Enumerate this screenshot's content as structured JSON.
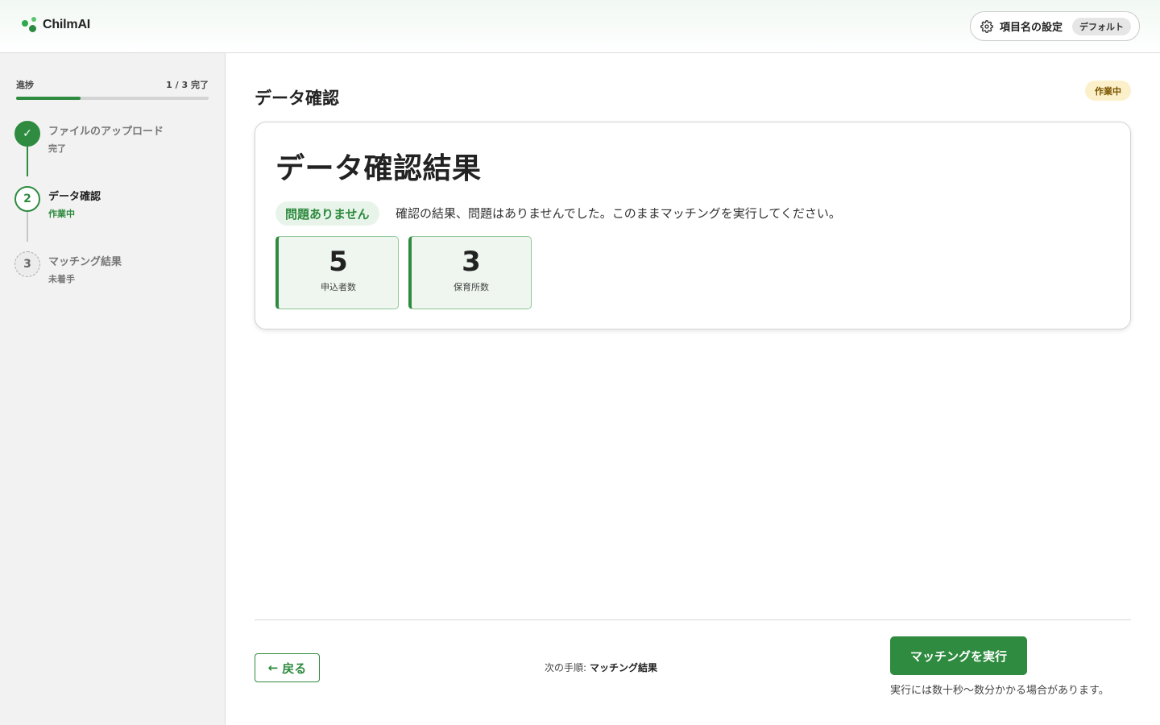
{
  "app": {
    "name": "ChilmAI",
    "settings_label": "項目名の設定",
    "settings_badge": "デフォルト"
  },
  "sidebar": {
    "progress_label": "進捗",
    "progress_count": "1 / 3 完了",
    "progress_fraction": 0.333,
    "steps": [
      {
        "marker": "✓",
        "title": "ファイルのアップロード",
        "status": "完了",
        "state": "done"
      },
      {
        "marker": "2",
        "title": "データ確認",
        "status": "作業中",
        "state": "active"
      },
      {
        "marker": "3",
        "title": "マッチング結果",
        "status": "未着手",
        "state": "todo"
      }
    ]
  },
  "main": {
    "page_title": "データ確認",
    "status_pill": "作業中",
    "card": {
      "title": "データ確認結果",
      "ok_badge": "問題ありません",
      "message": "確認の結果、問題はありませんでした。このままマッチングを実行してください。",
      "stats": [
        {
          "value": "5",
          "caption": "申込者数"
        },
        {
          "value": "3",
          "caption": "保育所数"
        }
      ]
    }
  },
  "footer": {
    "back_arrow": "←",
    "back_label": "戻る",
    "next_prefix": "次の手順:",
    "next_value": "マッチング結果",
    "run_label": "マッチングを実行",
    "run_note": "実行には数十秒〜数分かかる場合があります。"
  },
  "colors": {
    "accent": "#2e8b3f",
    "accent_bg": "#eef6ef",
    "working_bg": "#fbf0c9",
    "working_text": "#7a5400"
  },
  "icons": {
    "settings": "gear-icon",
    "logo": "chilmai-logo-mark",
    "back": "arrow-left-icon",
    "done": "check-icon"
  }
}
